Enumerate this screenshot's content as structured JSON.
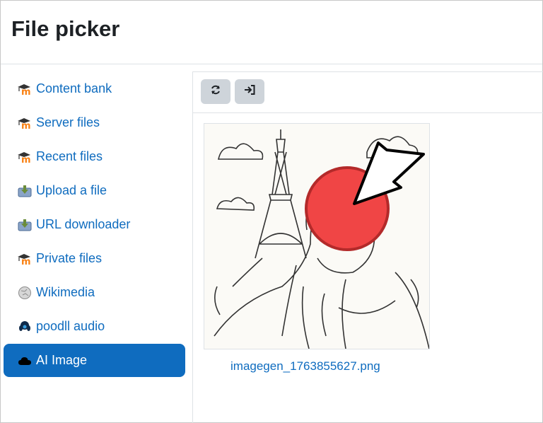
{
  "header": {
    "title": "File picker"
  },
  "sidebar": {
    "items": [
      {
        "label": "Content bank",
        "icon": "moodle-icon"
      },
      {
        "label": "Server files",
        "icon": "moodle-icon"
      },
      {
        "label": "Recent files",
        "icon": "moodle-icon"
      },
      {
        "label": "Upload a file",
        "icon": "upload-icon"
      },
      {
        "label": "URL downloader",
        "icon": "download-icon"
      },
      {
        "label": "Private files",
        "icon": "moodle-icon"
      },
      {
        "label": "Wikimedia",
        "icon": "wikipedia-icon"
      },
      {
        "label": "poodll audio",
        "icon": "poodll-icon"
      },
      {
        "label": "AI Image",
        "icon": "cloud-icon",
        "active": true
      }
    ]
  },
  "toolbar": {
    "refresh_icon": "refresh-icon",
    "logout_icon": "sign-in-icon"
  },
  "files": [
    {
      "name": "imagegen_1763855627.png"
    }
  ],
  "colors": {
    "accent": "#0f6cbf",
    "button_bg": "#ced4da",
    "moodle_orange": "#f98012",
    "cursor_marker": "#f04545"
  }
}
